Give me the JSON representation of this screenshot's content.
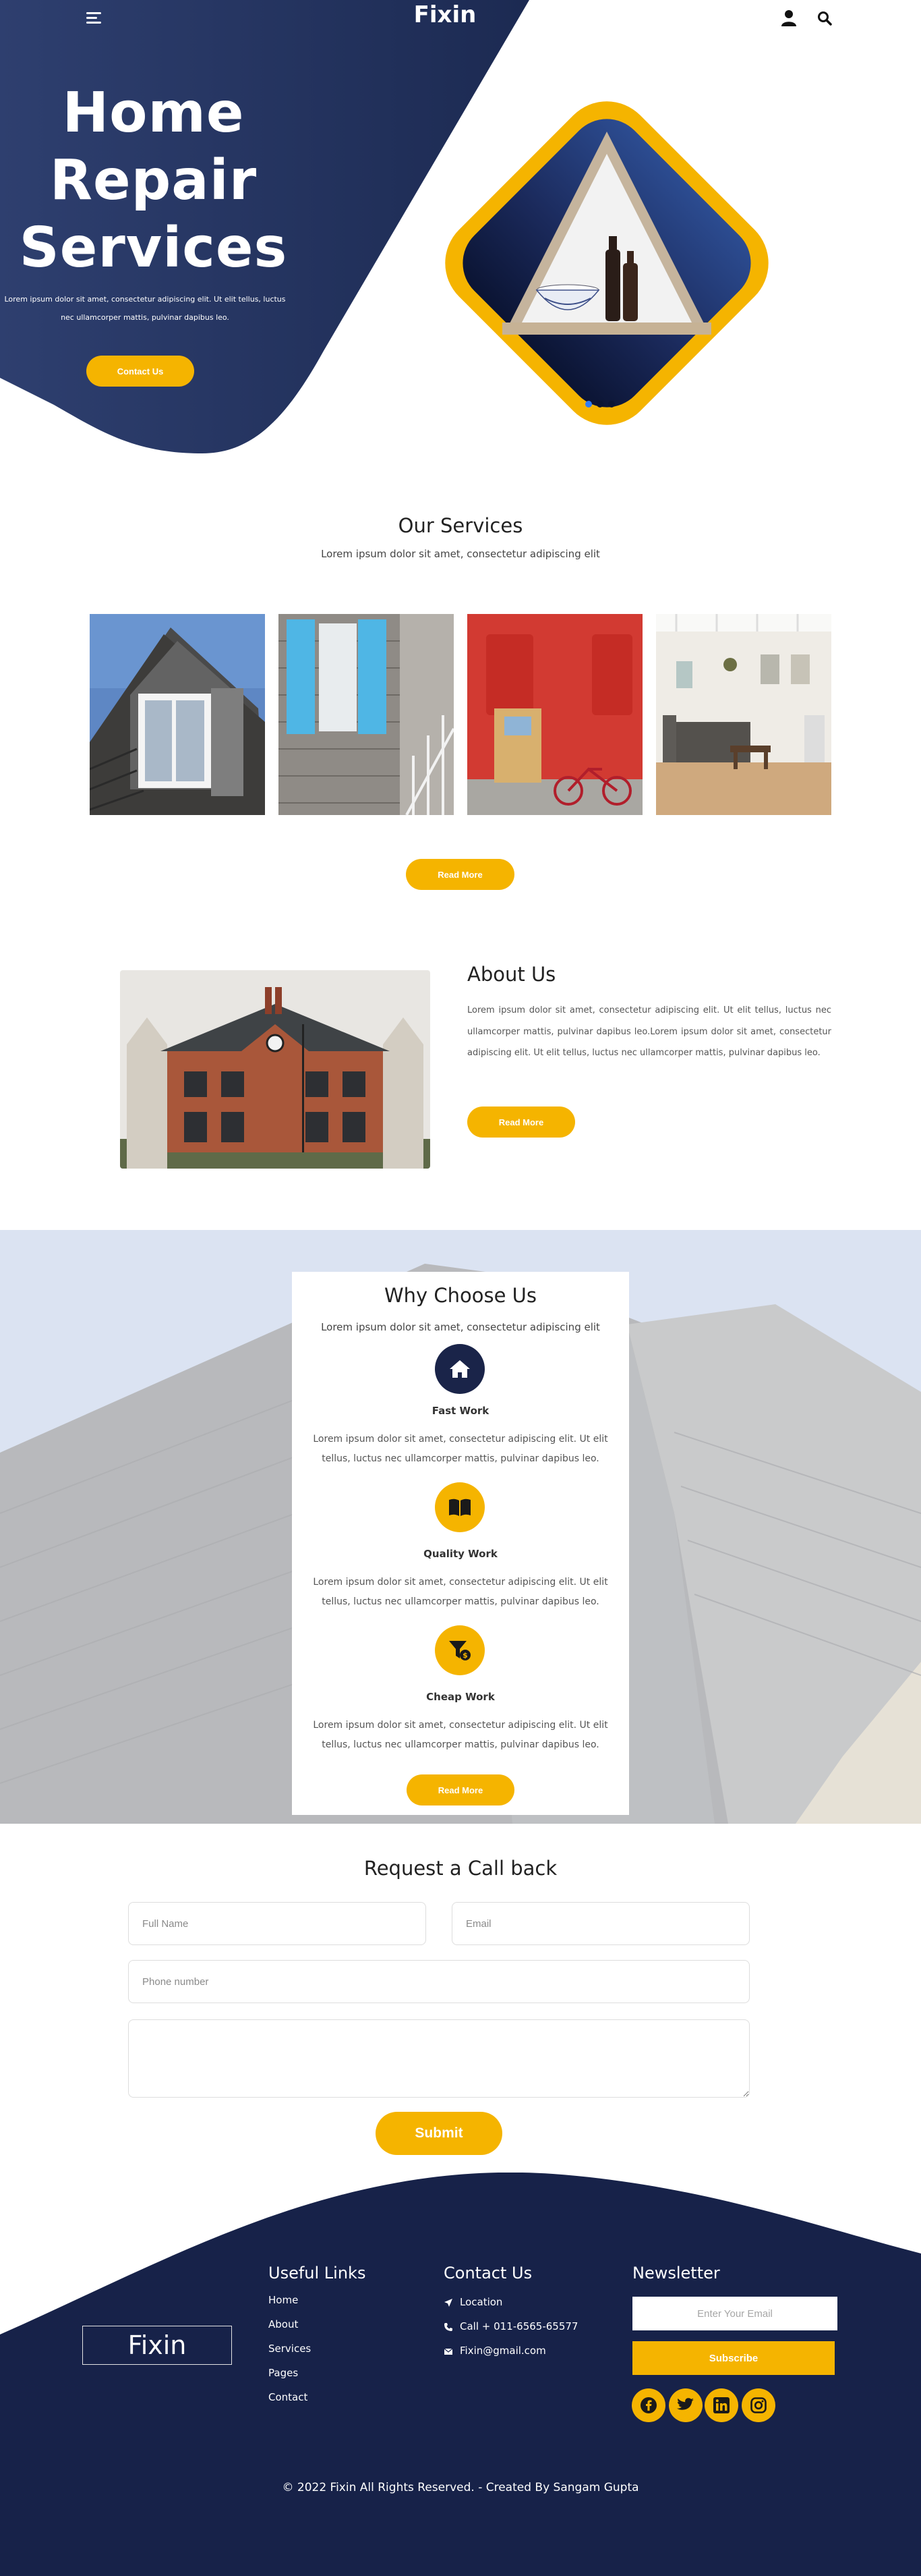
{
  "header": {
    "logo": "Fixin",
    "menu_icon": "menu-icon",
    "user_icon": "user-icon",
    "search_icon": "search-icon"
  },
  "hero": {
    "title_line1": "Home",
    "title_line2": "Repair",
    "title_line3": "Services",
    "desc_line1": "Lorem ipsum dolor sit amet, consectetur adipiscing elit. Ut elit tellus, luctus",
    "desc_line2": "nec ullamcorper mattis, pulvinar dapibus leo.",
    "contact_button": "Contact Us",
    "slider_dots": 3,
    "active_dot": 1
  },
  "services": {
    "title": "Our Services",
    "subtitle": "Lorem ipsum dolor sit amet, consectetur adipiscing elit",
    "read_more": "Read More"
  },
  "about": {
    "title": "About Us",
    "text": "Lorem ipsum dolor sit amet, consectetur adipiscing elit. Ut elit tellus, luctus nec ullamcorper mattis, pulvinar dapibus leo.Lorem ipsum dolor sit amet, consectetur adipiscing elit. Ut elit tellus, luctus nec ullamcorper mattis, pulvinar dapibus leo.",
    "read_more": "Read More"
  },
  "why": {
    "title": "Why Choose Us",
    "subtitle": "Lorem ipsum dolor sit amet, consectetur adipiscing elit",
    "features": [
      {
        "name": "Fast Work",
        "icon": "home-icon",
        "desc": "Lorem ipsum dolor sit amet, consectetur adipiscing elit. Ut elit tellus, luctus nec ullamcorper mattis, pulvinar dapibus leo."
      },
      {
        "name": "Quality Work",
        "icon": "book-icon",
        "desc": "Lorem ipsum dolor sit amet, consectetur adipiscing elit. Ut elit tellus, luctus nec ullamcorper mattis, pulvinar dapibus leo."
      },
      {
        "name": "Cheap Work",
        "icon": "funnel-dollar-icon",
        "desc": "Lorem ipsum dolor sit amet, consectetur adipiscing elit. Ut elit tellus, luctus nec ullamcorper mattis, pulvinar dapibus leo."
      }
    ],
    "read_more": "Read More"
  },
  "callback": {
    "title": "Request a Call back",
    "full_name_placeholder": "Full Name",
    "email_placeholder": "Email",
    "phone_placeholder": "Phone number",
    "message_placeholder": "",
    "submit": "Submit"
  },
  "footer": {
    "logo": "Fixin",
    "useful_links_title": "Useful Links",
    "links": [
      "Home",
      "About",
      "Services",
      "Pages",
      "Contact"
    ],
    "contact_title": "Contact Us",
    "contact": [
      {
        "icon": "location-arrow-icon",
        "text": "Location"
      },
      {
        "icon": "phone-icon",
        "text": "Call + 011-6565-65577"
      },
      {
        "icon": "envelope-icon",
        "text": "Fixin@gmail.com"
      }
    ],
    "newsletter_title": "Newsletter",
    "newsletter_placeholder": "Enter Your Email",
    "subscribe": "Subscribe",
    "social": [
      "facebook-icon",
      "twitter-icon",
      "linkedin-icon",
      "instagram-icon"
    ],
    "copyright": "© 2022 Fixin All Rights Reserved. - Created By Sangam Gupta"
  },
  "colors": {
    "navy": "#1a2449",
    "yellow": "#f5b400",
    "blue_dot": "#2f7cf6"
  }
}
